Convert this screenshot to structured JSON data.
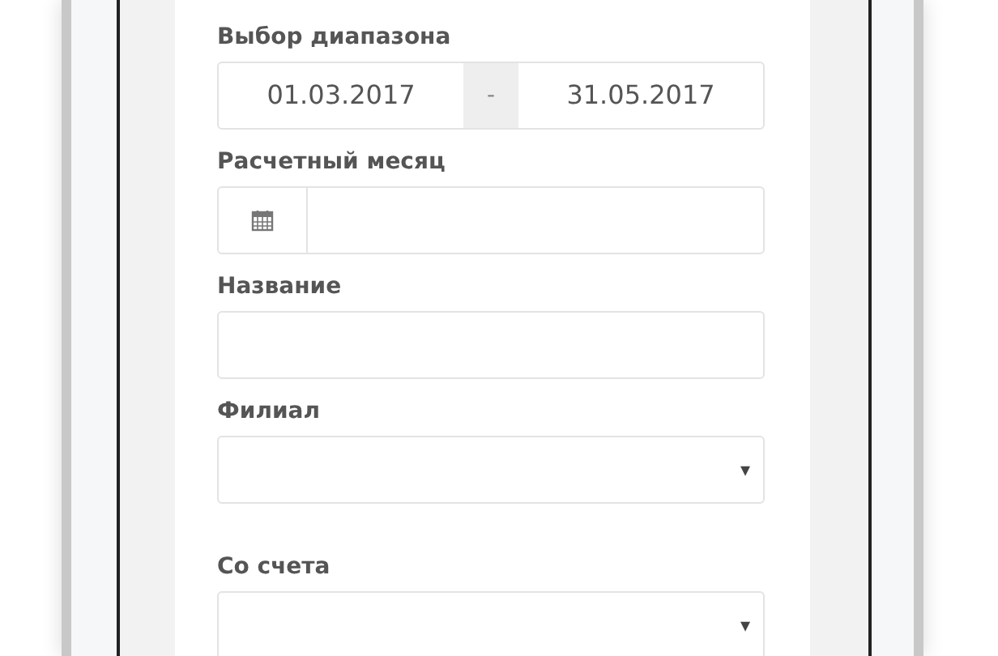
{
  "form": {
    "fields": [
      {
        "kind": "range",
        "label": "Выбор диапазона",
        "from": "01.03.2017",
        "separator": "-",
        "to": "31.05.2017"
      },
      {
        "kind": "date",
        "label": "Расчетный месяц"
      },
      {
        "kind": "text",
        "label": "Название"
      },
      {
        "kind": "select",
        "label": "Филиал",
        "arrow": "▾"
      },
      {
        "kind": "select",
        "label": "Со счета",
        "arrow": "▾"
      }
    ]
  }
}
